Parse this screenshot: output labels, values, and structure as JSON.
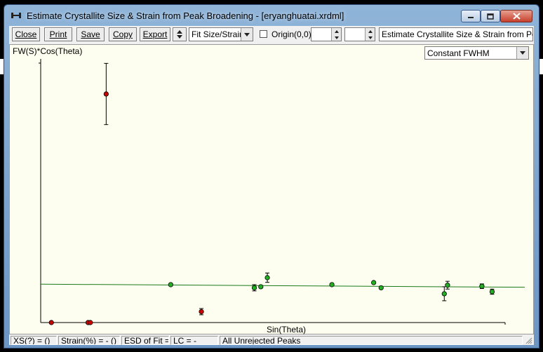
{
  "window": {
    "title": "Estimate Crystallite Size & Strain from Peak Broadening - [eryanghuatai.xrdml]"
  },
  "toolbar": {
    "close_label": "Close",
    "print_label": "Print",
    "save_label": "Save",
    "copy_label": "Copy",
    "export_label": "Export",
    "fit_mode": "Fit Size/Strain",
    "origin_label": "Origin(0,0)",
    "origin_checked": false,
    "spin1_value": "",
    "spin2_value": "",
    "description": "Estimate Crystallite Size & Strain from Peak Br"
  },
  "plot": {
    "method": "Constant FWHM"
  },
  "chart_data": {
    "type": "scatter",
    "title": "",
    "xlabel": "Sin(Theta)",
    "ylabel": "FW(S)*Cos(Theta)",
    "xlim": [
      0,
      1
    ],
    "ylim": [
      0,
      1
    ],
    "grid": false,
    "series": [
      {
        "color": "#d00000",
        "points": [
          {
            "x": 0.023,
            "y": 0.0,
            "err": 0.0
          },
          {
            "x": 0.102,
            "y": 0.0,
            "err": 0.0
          },
          {
            "x": 0.107,
            "y": 0.0,
            "err": 0.0
          },
          {
            "x": 0.141,
            "y": 0.881,
            "err": 0.118
          },
          {
            "x": 0.346,
            "y": 0.042,
            "err": 0.012
          }
        ]
      },
      {
        "color": "#20b020",
        "points": [
          {
            "x": 0.28,
            "y": 0.146,
            "err": 0.0
          },
          {
            "x": 0.46,
            "y": 0.134,
            "err": 0.012
          },
          {
            "x": 0.474,
            "y": 0.138,
            "err": 0.0
          },
          {
            "x": 0.488,
            "y": 0.173,
            "err": 0.018
          },
          {
            "x": 0.627,
            "y": 0.146,
            "err": 0.0
          },
          {
            "x": 0.717,
            "y": 0.154,
            "err": 0.0
          },
          {
            "x": 0.733,
            "y": 0.134,
            "err": 0.0
          },
          {
            "x": 0.869,
            "y": 0.111,
            "err": 0.027
          },
          {
            "x": 0.876,
            "y": 0.144,
            "err": 0.015
          },
          {
            "x": 0.95,
            "y": 0.14,
            "err": 0.009
          },
          {
            "x": 0.972,
            "y": 0.119,
            "err": 0.01
          }
        ]
      }
    ],
    "fit_line": {
      "color": "#1a7a1a",
      "y_start": 0.148,
      "y_end": 0.136
    }
  },
  "status": {
    "xs": "XS(?) = ()",
    "strain": "Strain(%) = - ()",
    "esd": "ESD of Fit =",
    "lc": "LC = -",
    "peaks": "All Unrejected Peaks"
  }
}
